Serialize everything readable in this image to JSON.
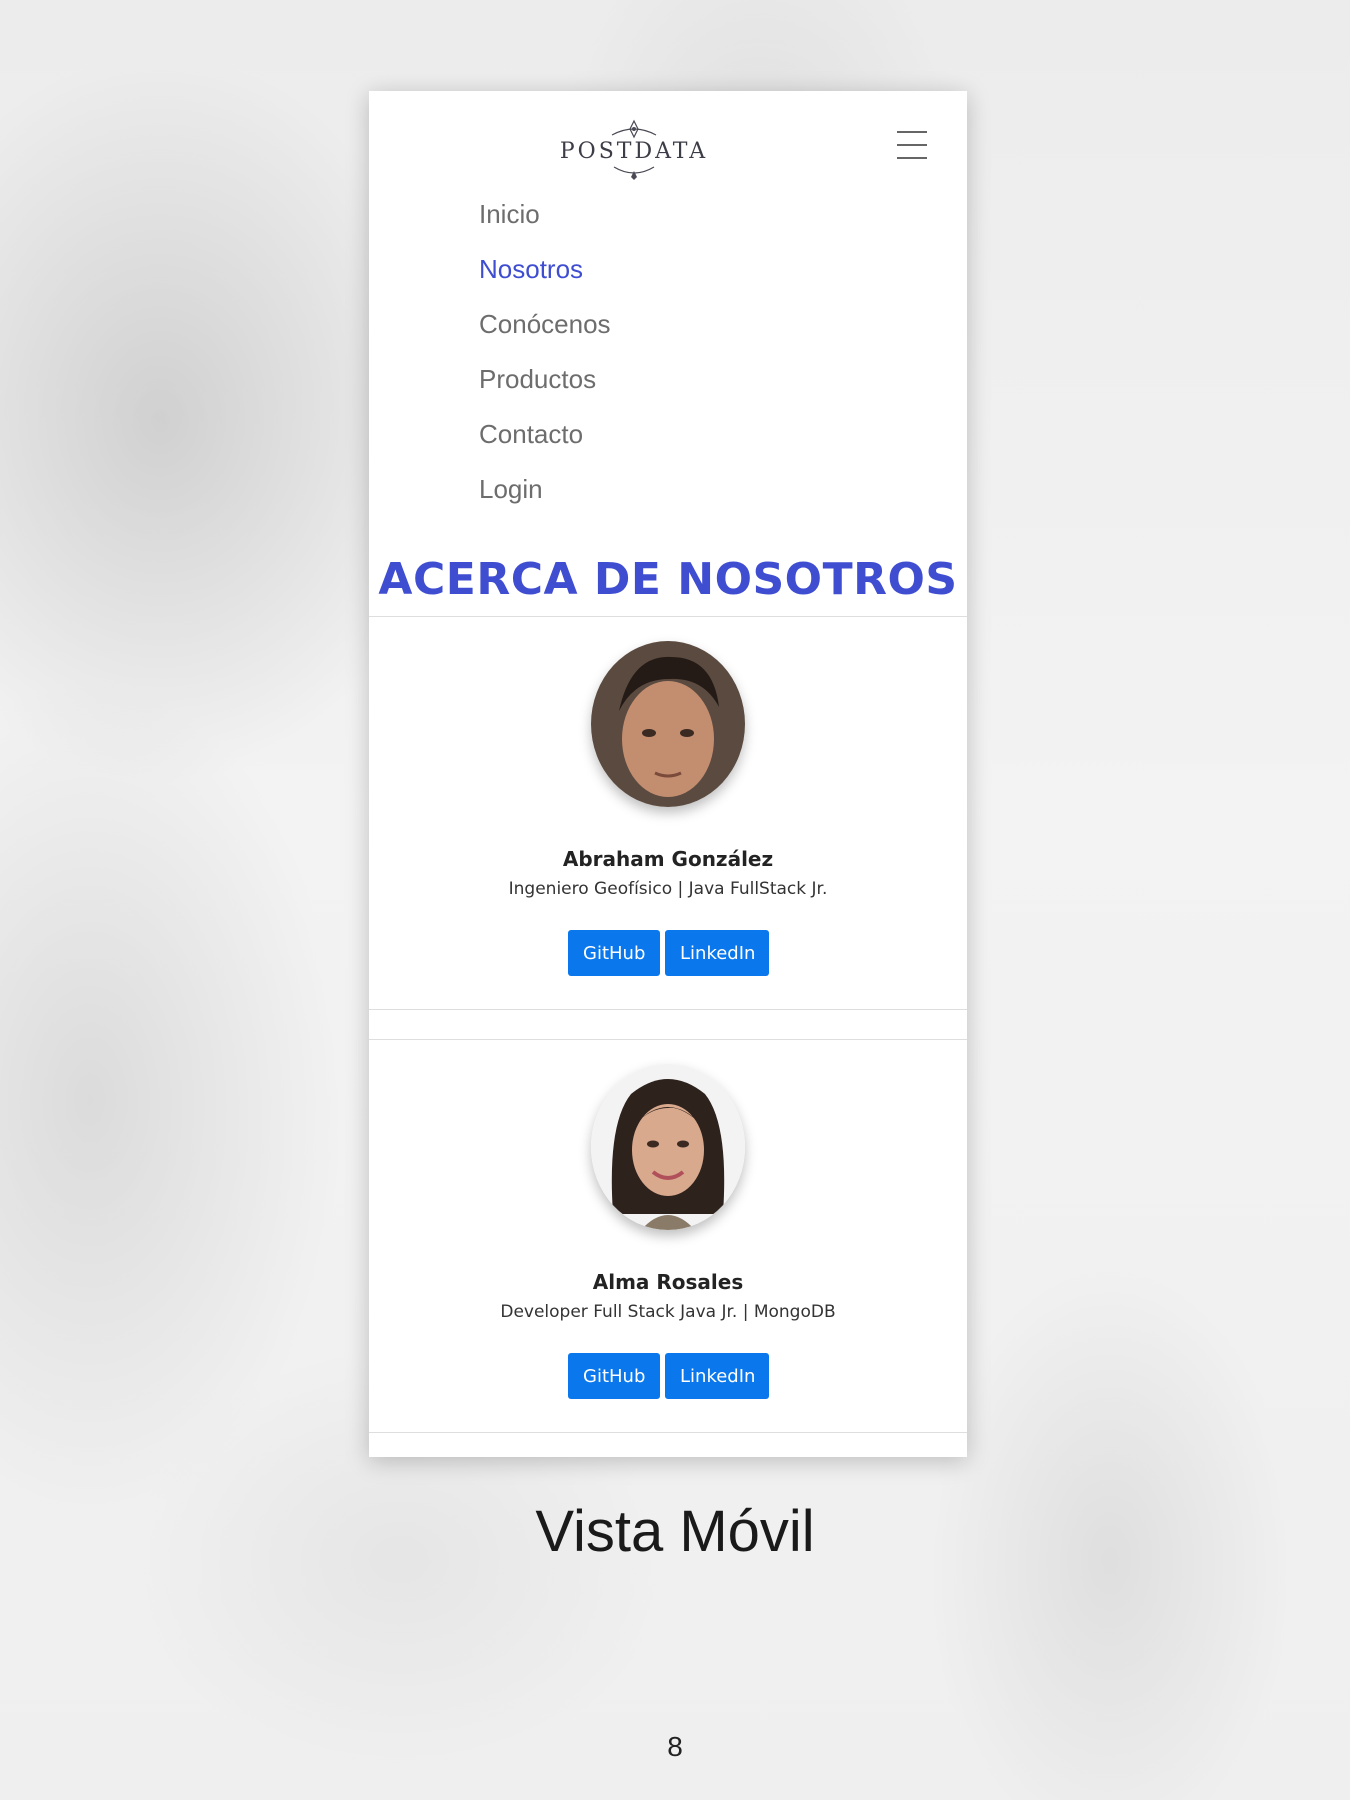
{
  "navbar": {
    "brand": "POSTDATA",
    "menu": [
      {
        "label": "Inicio",
        "active": false
      },
      {
        "label": "Nosotros",
        "active": true
      },
      {
        "label": "Conócenos",
        "active": false
      },
      {
        "label": "Productos",
        "active": false
      },
      {
        "label": "Contacto",
        "active": false
      },
      {
        "label": "Login",
        "active": false
      }
    ]
  },
  "page_heading": "ACERCA DE NOSOTROS",
  "team": [
    {
      "name": "Abraham González",
      "role": "Ingeniero Geofísico | Java FullStack Jr.",
      "github_label": "GitHub",
      "linkedin_label": "LinkedIn"
    },
    {
      "name": "Alma Rosales",
      "role": "Developer Full Stack Java Jr. | MongoDB",
      "github_label": "GitHub",
      "linkedin_label": "LinkedIn"
    }
  ],
  "caption": "Vista Móvil",
  "page_number": "8",
  "colors": {
    "accent": "#3f4ed1",
    "button": "#0a78ec"
  }
}
